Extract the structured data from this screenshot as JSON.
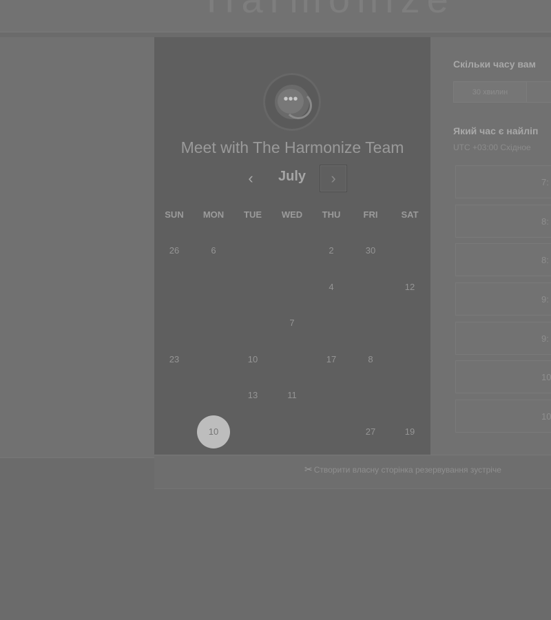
{
  "header": {
    "logo_text": "Harmonize"
  },
  "calendar": {
    "meeting_title": "Meet with The Harmonize Team",
    "month": "July",
    "prev_icon": "‹",
    "next_icon": "›",
    "weekdays": [
      "SUN",
      "MON",
      "TUE",
      "WED",
      "THU",
      "FRI",
      "SAT"
    ],
    "weeks": [
      [
        "26",
        "6",
        "",
        "",
        "2",
        "30",
        ""
      ],
      [
        "",
        "",
        "",
        "",
        "4",
        "",
        "12"
      ],
      [
        "",
        "",
        "",
        "7",
        "",
        "",
        ""
      ],
      [
        "23",
        "",
        "10",
        "",
        "17",
        "8",
        ""
      ],
      [
        "",
        "",
        "13",
        "11",
        "",
        "",
        ""
      ],
      [
        "",
        "10",
        "",
        "",
        "",
        "27",
        "19"
      ]
    ],
    "selected_day": "10"
  },
  "booking": {
    "duration_question": "Скільки часу вам",
    "durations": [
      "30 хвилин"
    ],
    "time_question": "Який час є найліп",
    "timezone": "UTC +03:00 Східное",
    "slots": [
      "7:",
      "8:",
      "8:",
      "9:",
      "9:",
      "10:",
      "10:"
    ]
  },
  "footer": {
    "create_link": "Створити власну сторінка резервування зустріче"
  },
  "icons": {
    "chat": "chat-bubble-icon",
    "prev": "chevron-left-icon",
    "next": "chevron-right-icon",
    "scissors": "scissors-icon"
  }
}
